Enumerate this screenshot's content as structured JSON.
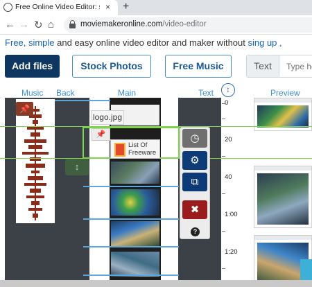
{
  "browser": {
    "tab_title": "Free Online Video Editor: simple",
    "tab_close": "×",
    "new_tab": "+",
    "url_host": "moviemakeronline.com",
    "url_path": "/video-editor"
  },
  "header": {
    "tagline_part1": "Free, simple",
    "tagline_part2": " and easy online video editor and maker without ",
    "tagline_part3": "sing up ,"
  },
  "toolbar": {
    "add_files": "Add files",
    "stock_photos": "Stock Photos",
    "free_music": "Free Music",
    "text_label": "Text",
    "text_placeholder": "Type he"
  },
  "columns": {
    "music": "Music",
    "back": "Back",
    "main": "Main",
    "text": "Text",
    "preview": "Preview"
  },
  "editor": {
    "logo_file": "logo.jpg",
    "logo_card_text": "List Of Freeware",
    "ruler": [
      "0",
      "20",
      "40",
      "1:00",
      "1:20"
    ]
  },
  "icons": {
    "pin": "pushpin-icon",
    "move": "vertical-arrows-icon",
    "sort": "vertical-arrows-icon",
    "clock": "clock-icon",
    "settings": "gear-icon",
    "copy": "copy-icon",
    "delete": "close-circle-icon",
    "help": "help-icon"
  },
  "colors": {
    "primary": "#0d3660",
    "link": "#1565c0",
    "accent_green": "#7bd64a",
    "accent_blue": "#5aa7e0",
    "delete": "#9b1c1c"
  }
}
